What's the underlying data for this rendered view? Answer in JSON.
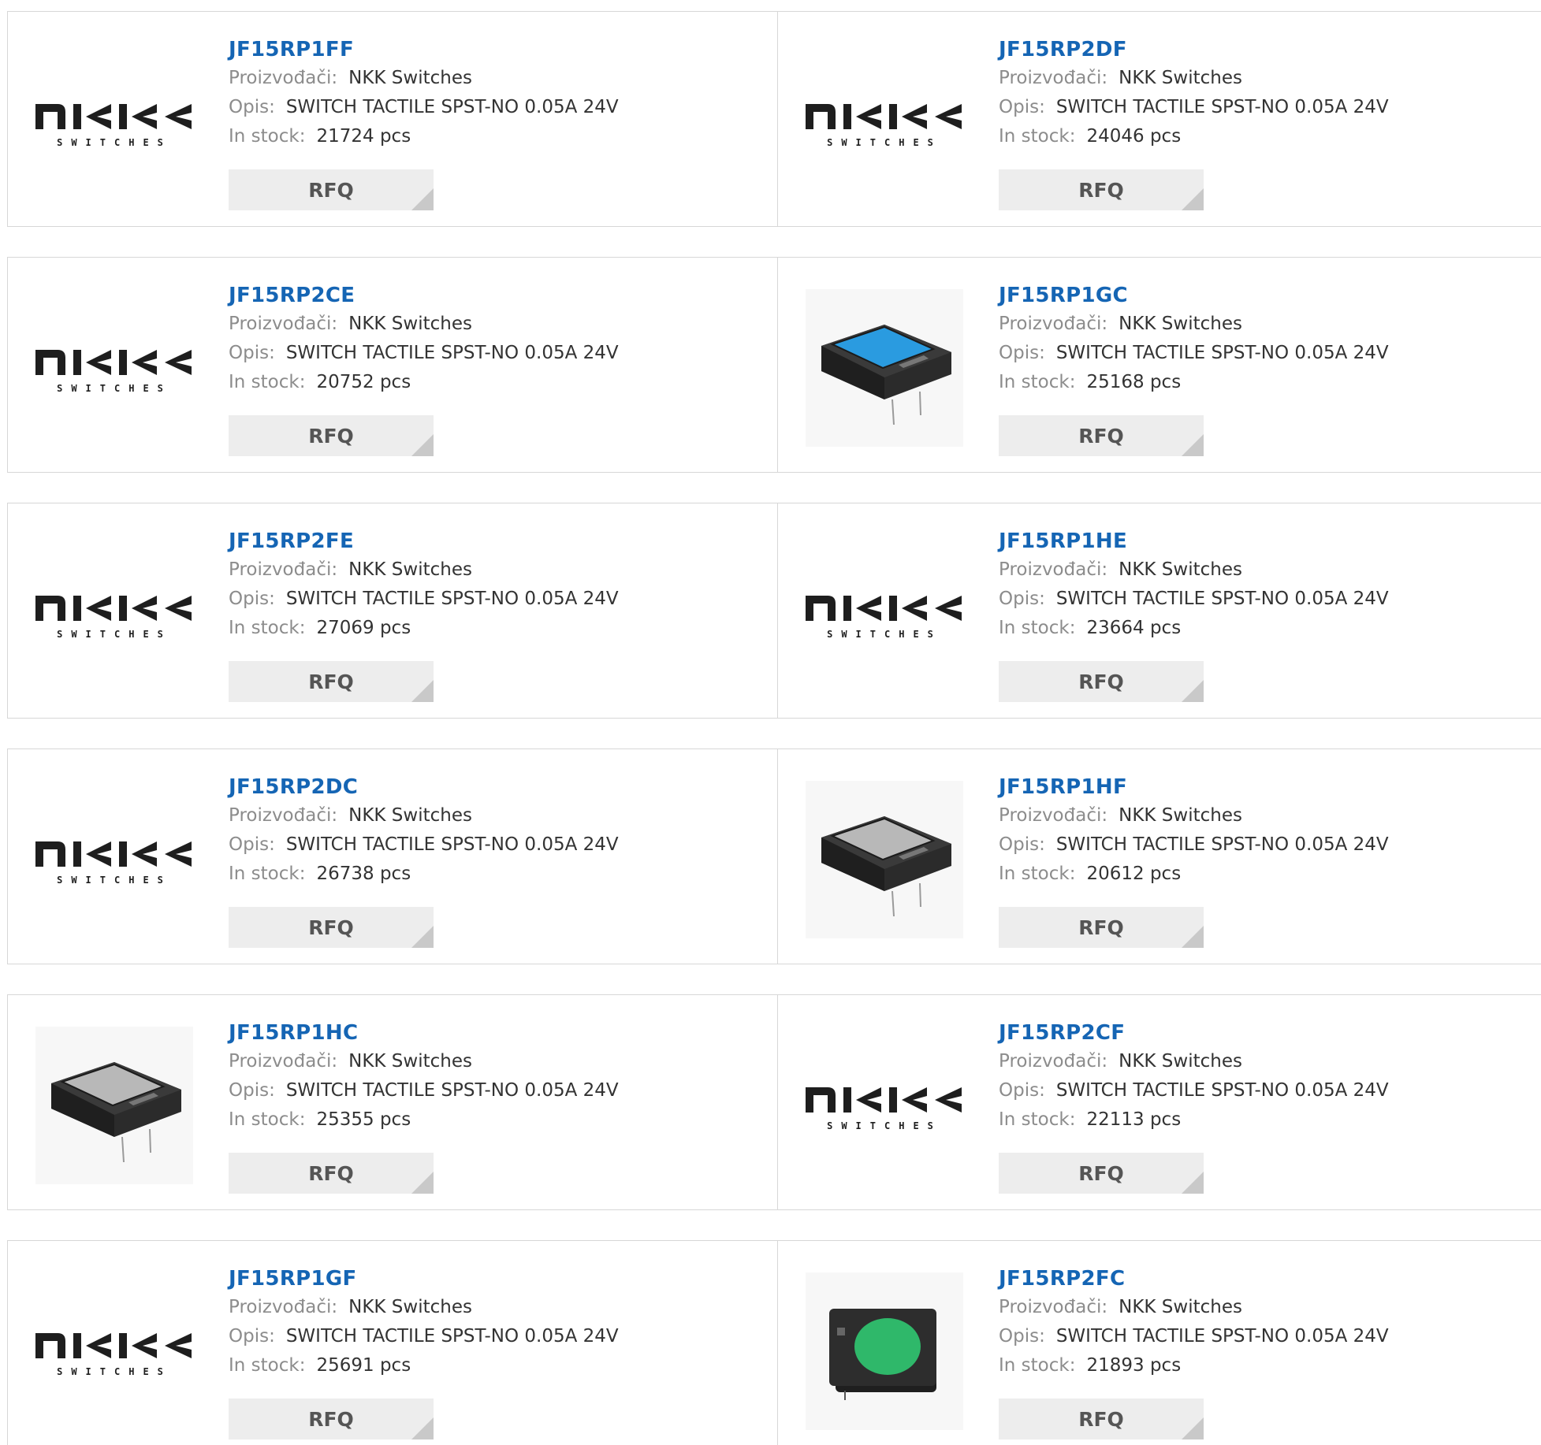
{
  "products": [
    {
      "part": "JF15RP1FF",
      "manufacturer": "NKK Switches",
      "description": "SWITCH TACTILE SPST-NO 0.05A 24V",
      "stock": "21724 pcs",
      "image": "nkk-logo"
    },
    {
      "part": "JF15RP2DF",
      "manufacturer": "NKK Switches",
      "description": "SWITCH TACTILE SPST-NO 0.05A 24V",
      "stock": "24046 pcs",
      "image": "nkk-logo"
    },
    {
      "part": "JF15RP2CE",
      "manufacturer": "NKK Switches",
      "description": "SWITCH TACTILE SPST-NO 0.05A 24V",
      "stock": "20752 pcs",
      "image": "nkk-logo"
    },
    {
      "part": "JF15RP1GC",
      "manufacturer": "NKK Switches",
      "description": "SWITCH TACTILE SPST-NO 0.05A 24V",
      "stock": "25168 pcs",
      "image": "switch-rect",
      "cap_color": "#2a9be0"
    },
    {
      "part": "JF15RP2FE",
      "manufacturer": "NKK Switches",
      "description": "SWITCH TACTILE SPST-NO 0.05A 24V",
      "stock": "27069 pcs",
      "image": "nkk-logo"
    },
    {
      "part": "JF15RP1HE",
      "manufacturer": "NKK Switches",
      "description": "SWITCH TACTILE SPST-NO 0.05A 24V",
      "stock": "23664 pcs",
      "image": "nkk-logo"
    },
    {
      "part": "JF15RP2DC",
      "manufacturer": "NKK Switches",
      "description": "SWITCH TACTILE SPST-NO 0.05A 24V",
      "stock": "26738 pcs",
      "image": "nkk-logo"
    },
    {
      "part": "JF15RP1HF",
      "manufacturer": "NKK Switches",
      "description": "SWITCH TACTILE SPST-NO 0.05A 24V",
      "stock": "20612 pcs",
      "image": "switch-rect",
      "cap_color": "#b8b8b8"
    },
    {
      "part": "JF15RP1HC",
      "manufacturer": "NKK Switches",
      "description": "SWITCH TACTILE SPST-NO 0.05A 24V",
      "stock": "25355 pcs",
      "image": "switch-rect",
      "cap_color": "#b8b8b8"
    },
    {
      "part": "JF15RP2CF",
      "manufacturer": "NKK Switches",
      "description": "SWITCH TACTILE SPST-NO 0.05A 24V",
      "stock": "22113 pcs",
      "image": "nkk-logo"
    },
    {
      "part": "JF15RP1GF",
      "manufacturer": "NKK Switches",
      "description": "SWITCH TACTILE SPST-NO 0.05A 24V",
      "stock": "25691 pcs",
      "image": "nkk-logo"
    },
    {
      "part": "JF15RP2FC",
      "manufacturer": "NKK Switches",
      "description": "SWITCH TACTILE SPST-NO 0.05A 24V",
      "stock": "21893 pcs",
      "image": "switch-square",
      "cap_color": "#2fb86a"
    }
  ],
  "labels": {
    "manufacturer": "Proizvođači:",
    "description": "Opis:",
    "stock": "In stock:",
    "rfq": "RFQ"
  },
  "logo": {
    "brand_text": "NKK",
    "sub_text": "SWITCHES",
    "color": "#1e1e1e",
    "accent": "#a31b24"
  },
  "colors": {
    "part_link": "#1565b4",
    "label": "#8c8c8c",
    "border": "#d7d7d7",
    "rfq_bg": "#ededed"
  }
}
